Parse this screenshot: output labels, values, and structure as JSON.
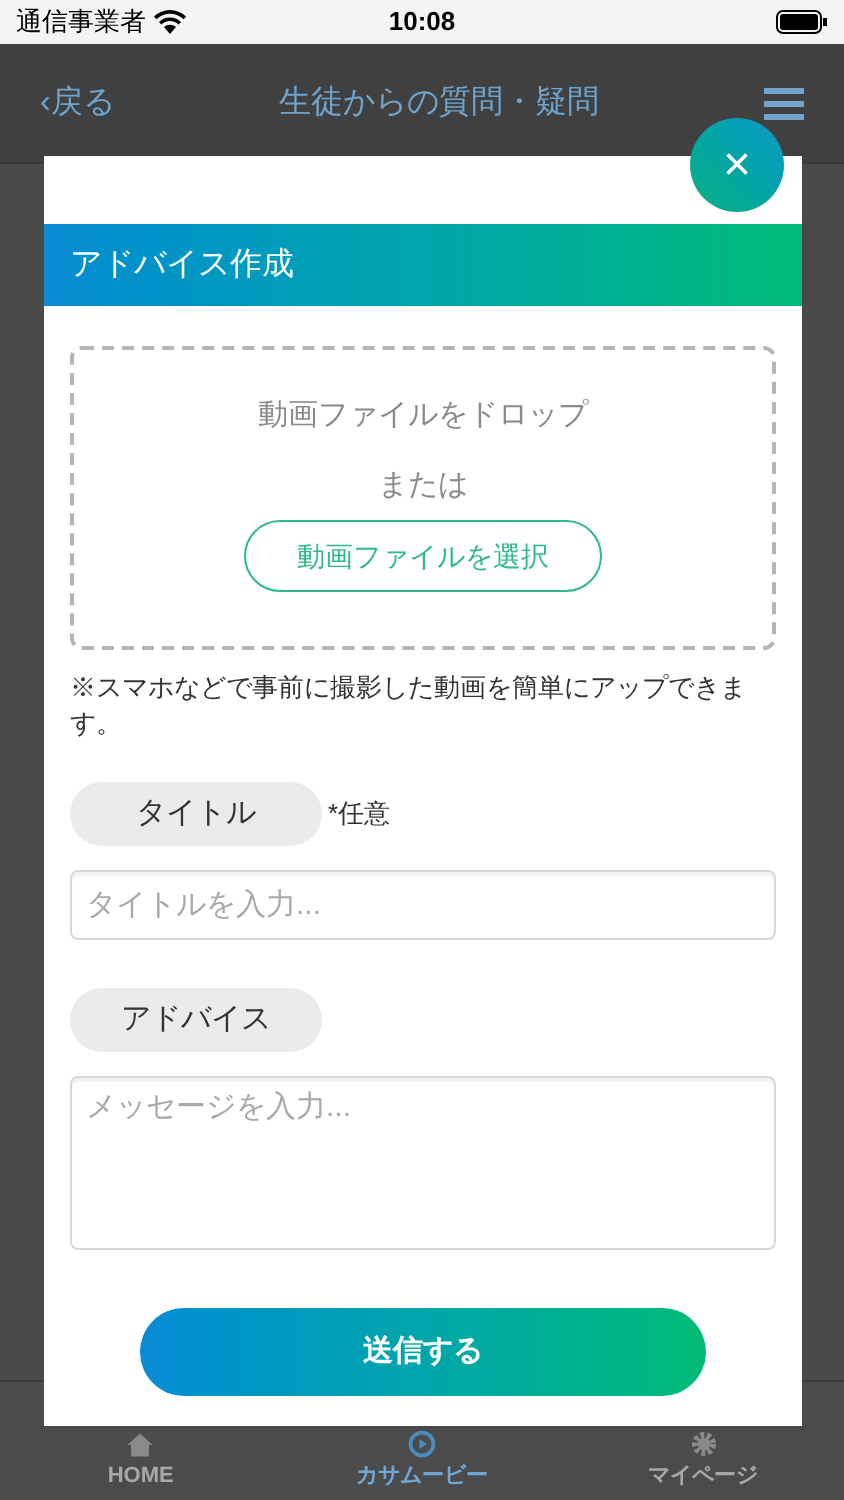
{
  "status_bar": {
    "carrier": "通信事業者",
    "time": "10:08"
  },
  "header": {
    "back": "‹戻る",
    "title": "生徒からの質問・疑問"
  },
  "tabs": [
    {
      "label": "HOME",
      "kind": "home",
      "selected": false
    },
    {
      "label": "カサムービー",
      "kind": "play",
      "selected": true
    },
    {
      "label": "マイページ",
      "kind": "gear",
      "selected": false
    }
  ],
  "modal": {
    "title": "アドバイス作成",
    "close": "×",
    "drop_zone": {
      "text": "動画ファイルをドロップ",
      "or": "または",
      "button": "動画ファイルを選択"
    },
    "note": "※スマホなどで事前に撮影した動画を簡単にアップできます。",
    "fields": [
      {
        "kind": "line",
        "label": "タイトル",
        "hint": "*任意",
        "placeholder": "タイトルを入力..."
      },
      {
        "kind": "area",
        "label": "アドバイス",
        "placeholder": "メッセージを入力..."
      }
    ],
    "submit": "送信する"
  }
}
